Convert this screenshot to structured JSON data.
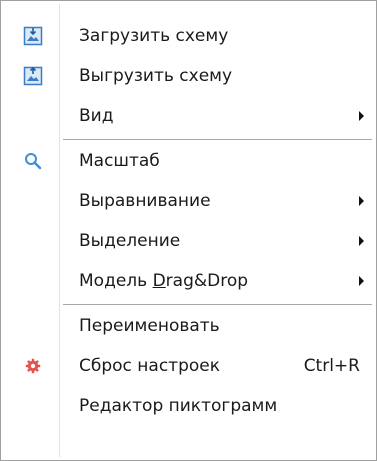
{
  "menu": {
    "items": [
      {
        "label": "Загрузить схему",
        "icon": "load-scheme-icon"
      },
      {
        "label": "Выгрузить схему",
        "icon": "unload-scheme-icon"
      },
      {
        "label": "Вид",
        "submenu": true
      },
      {
        "label": "Масштаб",
        "icon": "magnifier-icon"
      },
      {
        "label": "Выравнивание",
        "submenu": true
      },
      {
        "label": "Выделение",
        "submenu": true
      },
      {
        "label_prefix": "Модель ",
        "label_accel": "D",
        "label_suffix": "rag&Drop",
        "submenu": true
      },
      {
        "label": "Переименовать"
      },
      {
        "label": "Сброс настроек",
        "shortcut": "Ctrl+R",
        "icon": "reset-settings-icon"
      },
      {
        "label": "Редактор пиктограмм"
      }
    ]
  },
  "colors": {
    "border": "#a0a0a0",
    "separator": "#a9a9a9",
    "scheme_icon": "#3b7cc4",
    "magnifier": "#3c8fd6",
    "reset_icon": "#e4514f"
  }
}
